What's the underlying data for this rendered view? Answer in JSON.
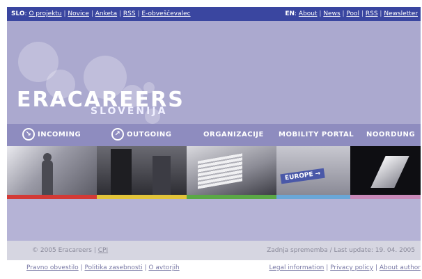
{
  "topbar": {
    "slo_label": "SLO",
    "slo_links": [
      "O projektu",
      "Novice",
      "Anketa",
      "RSS",
      "E-obveščevalec"
    ],
    "en_label": "EN",
    "en_links": [
      "About",
      "News",
      "Pool",
      "RSS",
      "Newsletter"
    ]
  },
  "header": {
    "logo_main": "ERACAREERS",
    "logo_sub": "SLOVENIJA"
  },
  "nav": {
    "items": [
      "INCOMING",
      "OUTGOING",
      "ORGANIZACIJE",
      "MOBILITY PORTAL",
      "NOORDUNG"
    ]
  },
  "photos": {
    "europe_sign": "EUROPE →"
  },
  "stripes": {
    "colors": [
      "#d33a36",
      "#e2c43a",
      "#5aa845",
      "#6aa7d8",
      "#c889b8"
    ]
  },
  "footer": {
    "copyright": "© 2005 Eracareers",
    "cpi_link": "CPI",
    "last_update": "Zadnja sprememba / Last update: 19. 04. 2005",
    "links_si": [
      "Pravno obvestilo",
      "Politika zasebnosti",
      "O avtorjih"
    ],
    "links_en": [
      "Legal information",
      "Privacy policy",
      "About author"
    ]
  }
}
